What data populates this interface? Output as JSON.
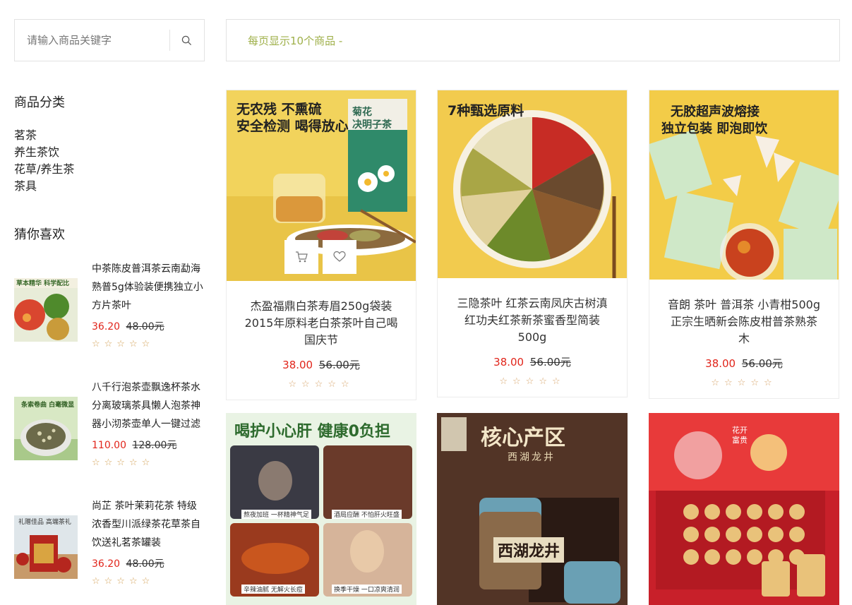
{
  "search": {
    "placeholder": "请输入商品关键字"
  },
  "toolbar": {
    "per_page_text": "每页显示10个商品 -"
  },
  "sidebar": {
    "categories_title": "商品分类",
    "categories": [
      "茗茶",
      "养生茶饮",
      "花草/养生茶",
      "茶具"
    ],
    "recommend_title": "猜你喜欢",
    "recommend": [
      {
        "name": "中茶陈皮普洱茶云南勐海熟普5g体验装便携独立小方片茶叶",
        "price": "36.20",
        "old_price": "48.00元",
        "stars": "☆☆☆☆☆",
        "image_text": "草本精华 科学配比"
      },
      {
        "name": "八千行泡茶壶飘逸杯茶水分离玻璃茶具懒人泡茶神器小沏茶壶单人一键过滤",
        "price": "110.00",
        "old_price": "128.00元",
        "stars": "☆☆☆☆☆",
        "image_text": "条索卷曲 白毫微显"
      },
      {
        "name": "尚芷 茶叶茉莉花茶 特级浓香型川派绿茶花草茶自饮送礼茗茶罐装",
        "price": "36.20",
        "old_price": "48.00元",
        "stars": "☆☆☆☆☆",
        "image_text": "礼赠佳品 高端茶礼"
      }
    ]
  },
  "products": [
    {
      "name": "杰盈福鼎白茶寿眉250g袋装2015年原料老白茶茶叶自己喝国庆节",
      "price": "38.00",
      "old_price": "56.00元",
      "stars": "☆☆☆☆☆",
      "image_lines": [
        "无农残 不熏硫",
        "安全检测 喝得放心"
      ],
      "box_text": [
        "菊花",
        "决明子茶"
      ]
    },
    {
      "name": "三隐茶叶 红茶云南凤庆古树滇红功夫红茶新茶蜜香型简装500g",
      "price": "38.00",
      "old_price": "56.00元",
      "stars": "☆☆☆☆☆",
      "image_lines": [
        "7种甄选原料"
      ]
    },
    {
      "name": "音朗 茶叶 普洱茶 小青柑500g 正宗生晒新会陈皮柑普茶熟茶木",
      "price": "38.00",
      "old_price": "56.00元",
      "stars": "☆☆☆☆☆",
      "image_lines": [
        "无胶超声波熔接",
        "独立包装 即泡即饮"
      ]
    },
    {
      "image_lines": [
        "喝护小心肝 健康0负担"
      ],
      "captions": [
        "熬夜加班 一杯精神气足",
        "酒局应酬 不怕肝火旺盛",
        "辛辣油腻 无解火长痘",
        "换季干燥 一口凉爽清润"
      ]
    },
    {
      "image_lines": [
        "核心产区",
        "西湖龙井"
      ],
      "box_text": "西湖龙井"
    },
    {
      "image_lines": [
        "花开",
        "富贵"
      ]
    }
  ],
  "colors": {
    "price": "#e1251b",
    "star": "#d4a35a",
    "toolbar_text": "#9fb04a"
  }
}
